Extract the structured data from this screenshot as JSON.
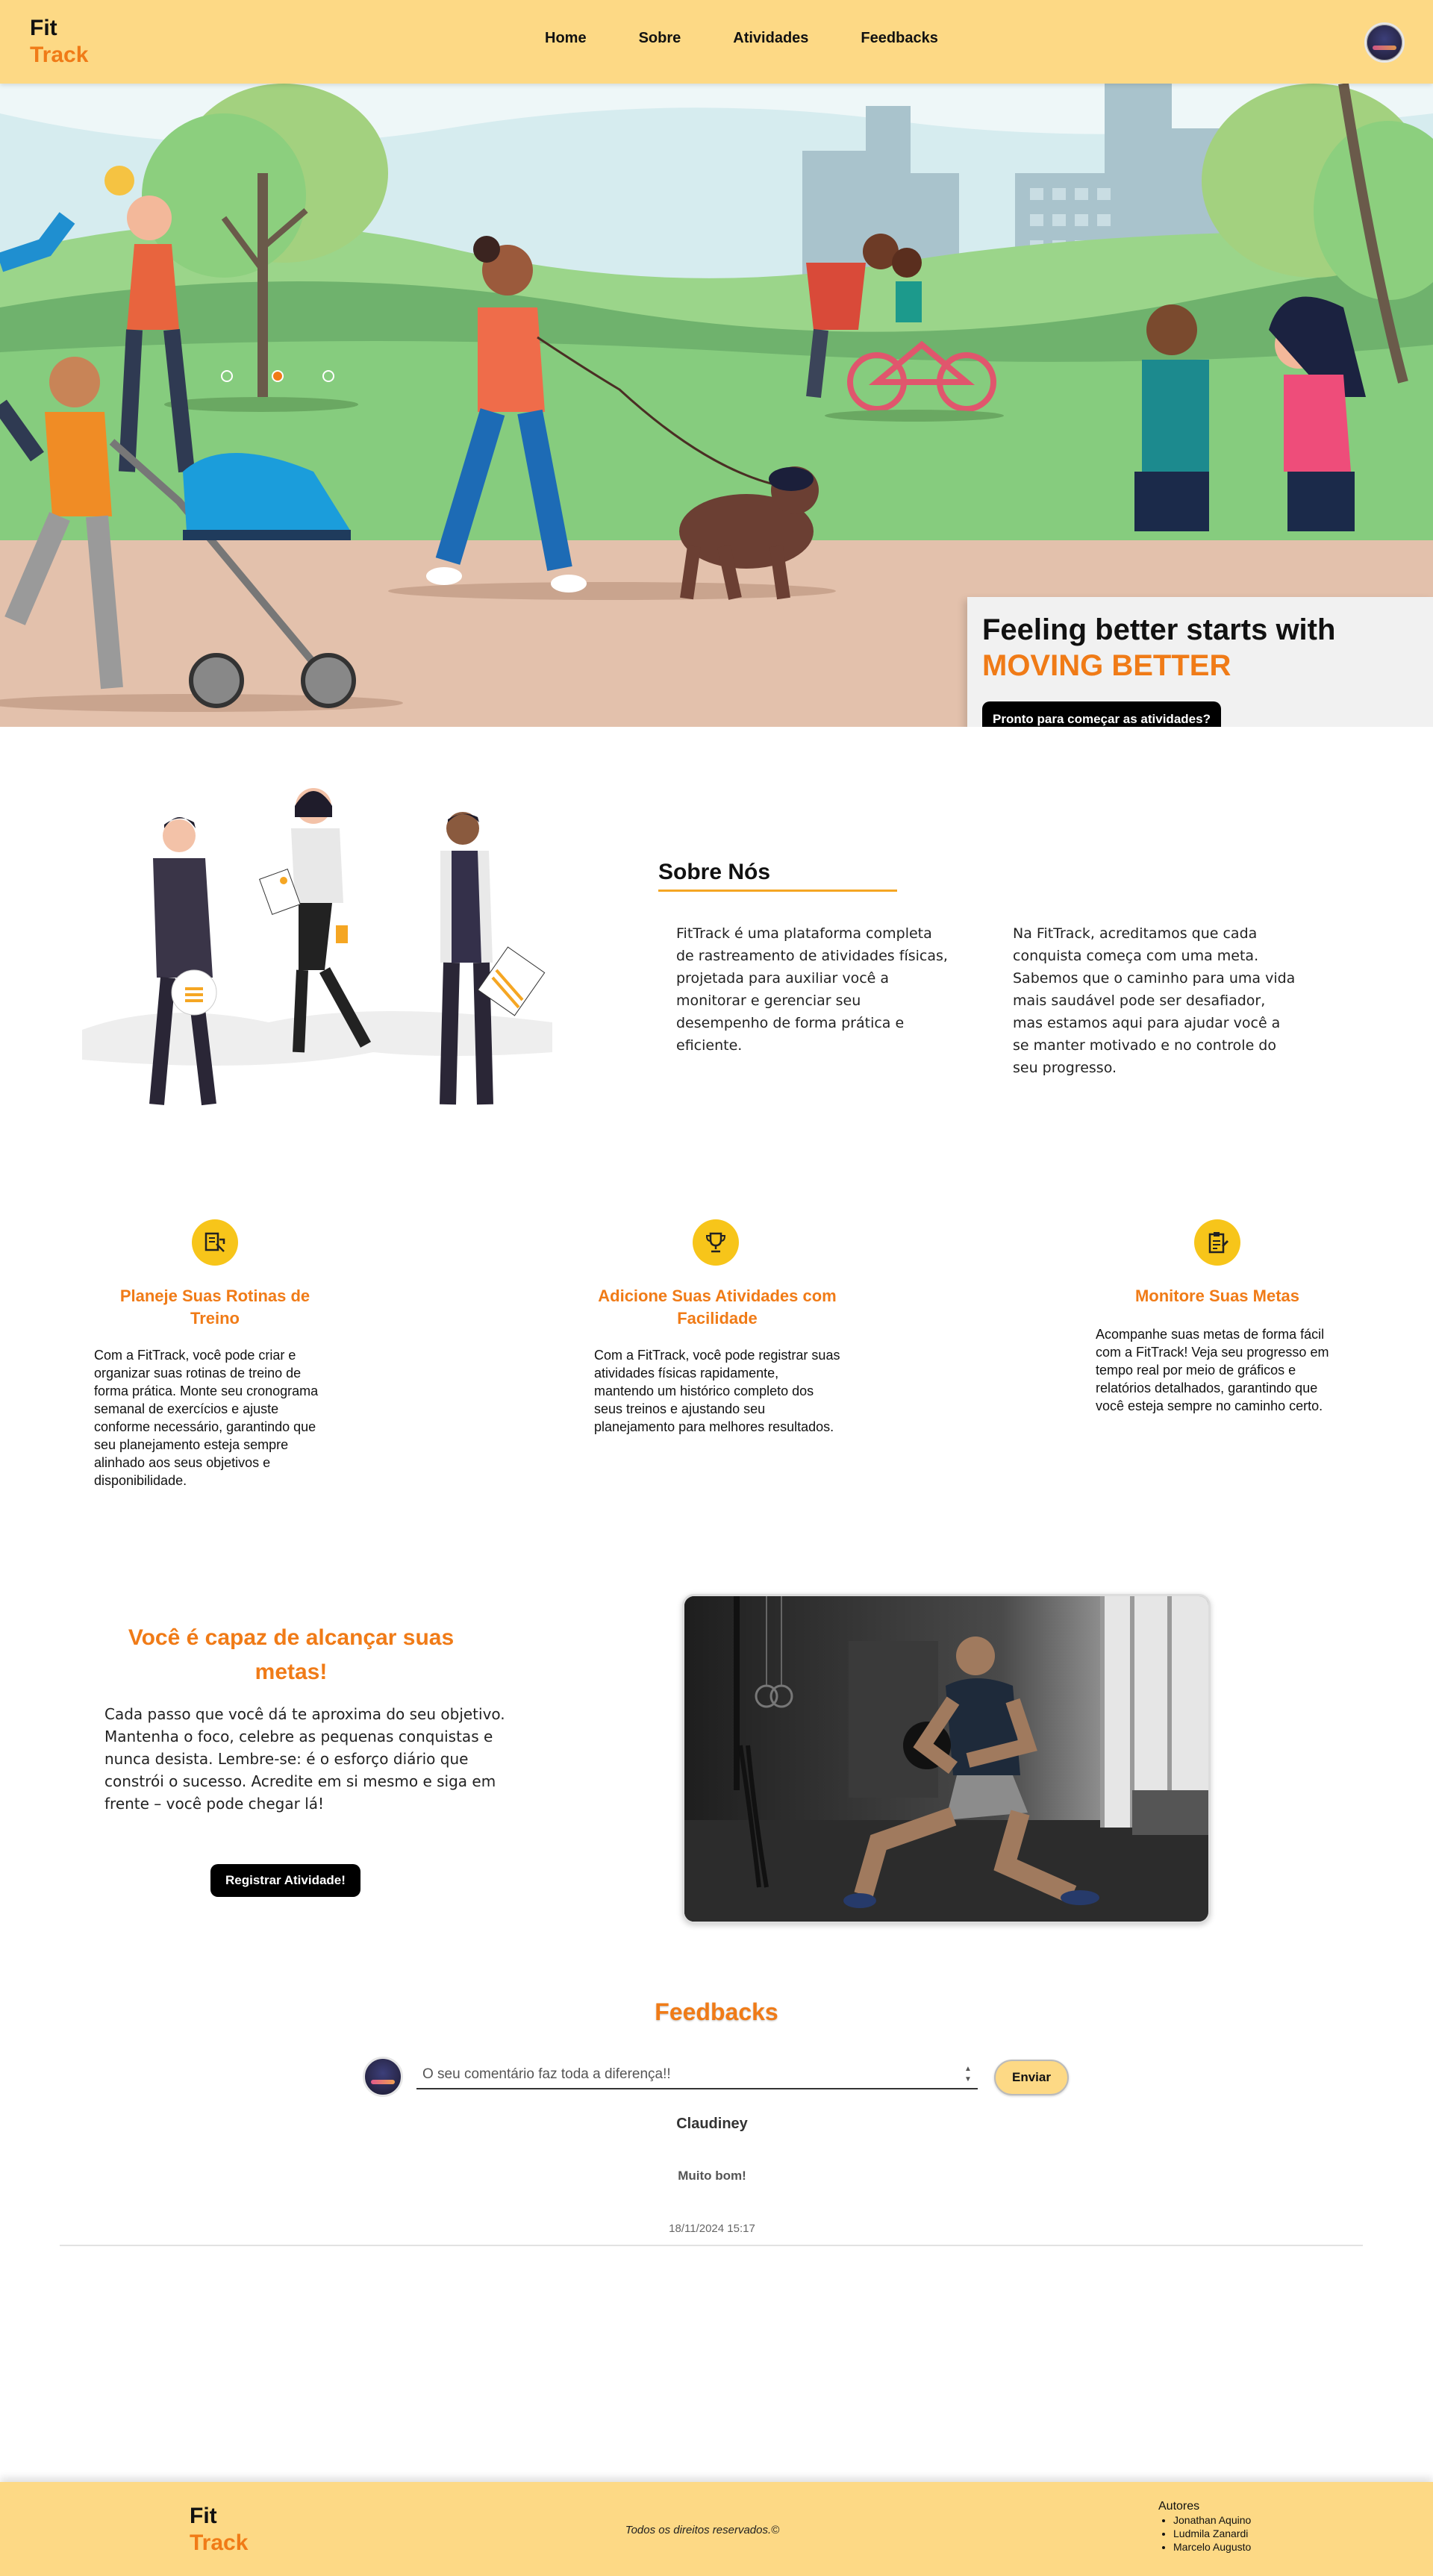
{
  "header": {
    "logo_line1": "Fit",
    "logo_line2": "Track",
    "nav": [
      "Home",
      "Sobre",
      "Atividades",
      "Feedbacks"
    ]
  },
  "hero": {
    "title": "Feeling better starts with",
    "highlight": "MOVING BETTER",
    "cta": "Pronto para começar as atividades?",
    "carousel_dots": 3,
    "active_dot": 1
  },
  "about": {
    "title": "Sobre Nós",
    "paragraph1": "FitTrack é uma plataforma completa de rastreamento de atividades físicas, projetada para auxiliar você a monitorar e gerenciar seu desempenho de forma prática e eficiente.",
    "paragraph2": "Na FitTrack, acreditamos que cada conquista começa com uma meta. Sabemos que o caminho para uma vida mais saudável pode ser desafiador, mas estamos aqui para ajudar você a se manter motivado e no controle do seu progresso."
  },
  "features": [
    {
      "icon": "routine-icon",
      "title": "Planeje Suas Rotinas de Treino",
      "text": "Com a FitTrack, você pode criar e organizar suas rotinas de treino de forma prática. Monte seu cronograma semanal de exercícios e ajuste conforme necessário, garantindo que seu planejamento esteja sempre alinhado aos seus objetivos e disponibilidade."
    },
    {
      "icon": "trophy-icon",
      "title": "Adicione Suas Atividades com Facilidade",
      "text": "Com a FitTrack, você pode registrar suas atividades físicas rapidamente, mantendo um histórico completo dos seus treinos e ajustando seu planejamento para melhores resultados."
    },
    {
      "icon": "clipboard-icon",
      "title": "Monitore Suas Metas",
      "text": "Acompanhe suas metas de forma fácil com a FitTrack! Veja seu progresso em tempo real por meio de gráficos e relatórios detalhados, garantindo que você esteja sempre no caminho certo."
    }
  ],
  "motivation": {
    "title": "Você é capaz de alcançar suas metas!",
    "text": "Cada passo que você dá te aproxima do seu objetivo. Mantenha o foco, celebre as pequenas conquistas e nunca desista. Lembre-se: é o esforço diário que constrói o sucesso. Acredite em si mesmo e siga em frente – você pode chegar lá!",
    "button": "Registrar Atividade!"
  },
  "feedbacks": {
    "title": "Feedbacks",
    "placeholder": "O seu comentário faz toda a diferença!!",
    "send": "Enviar",
    "items": [
      {
        "name": "Claudiney",
        "message": "Muito bom!",
        "date": "18/11/2024 15:17"
      }
    ]
  },
  "footer": {
    "logo_line1": "Fit",
    "logo_line2": "Track",
    "copyright": "Todos os direitos reservados.©",
    "authors_title": "Autores",
    "authors": [
      "Jonathan Aquino",
      "Ludmila Zanardi",
      "Marcelo Augusto"
    ]
  },
  "colors": {
    "accent": "#f07b17",
    "header_bg": "#fdd985",
    "icon_bg": "#f7c51a"
  }
}
